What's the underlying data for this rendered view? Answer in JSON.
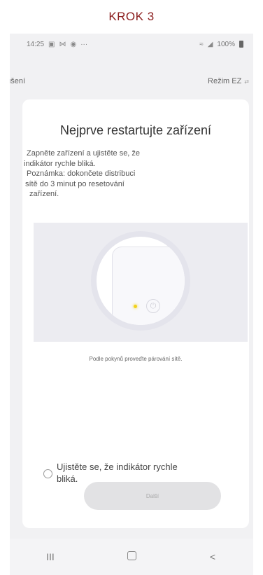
{
  "step_label": "KROK 3",
  "status_bar": {
    "time": "14:25",
    "icons_left": [
      "gallery-icon",
      "message-icon",
      "messenger-icon"
    ],
    "more": "···",
    "battery": "100%"
  },
  "top_bar": {
    "cancel_label": "zrušení",
    "mode_label": "Režim EZ"
  },
  "card": {
    "title": "Nejprve restartujte zařízení",
    "description": [
      "Zapněte zařízení a ujistěte se, že",
      "indikátor rychle bliká.",
      "Poznámka: dokončete distribuci",
      "sítě do 3 minut po resetování",
      "zařízení."
    ],
    "caption": "Podle pokynů proveďte párování sítě.",
    "checkbox_label_line1": "Ujistěte se, že indikátor rychle",
    "checkbox_label_line2": "bliká.",
    "checkbox_checked": false,
    "next_label": "Další"
  },
  "nav_bar": {
    "recent": "III",
    "back": "<"
  },
  "colors": {
    "step_label": "#8a1c1c",
    "led": "#f2d21b",
    "button_disabled": "#e2e2e4"
  }
}
